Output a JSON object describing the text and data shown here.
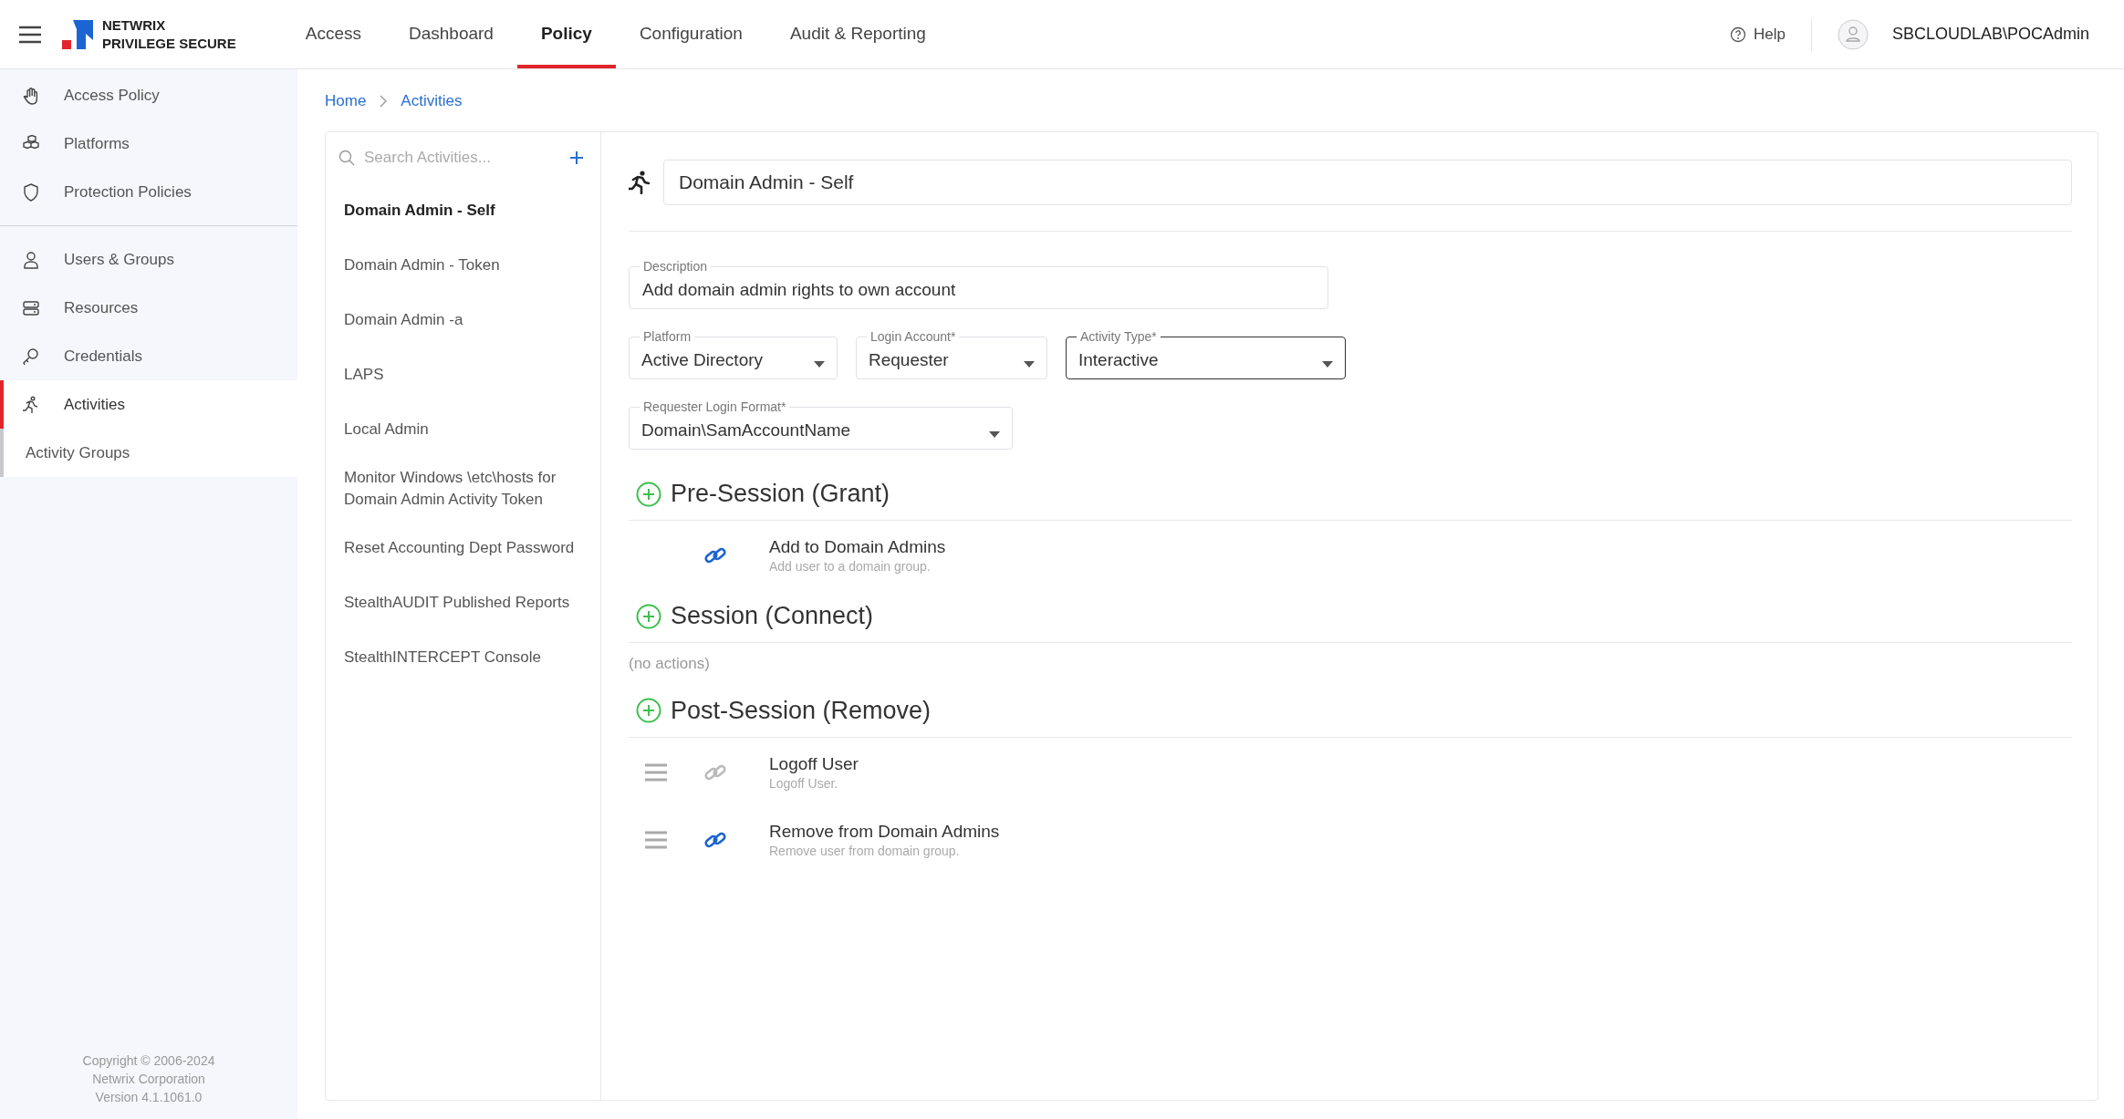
{
  "header": {
    "brand_line1": "NETWRIX",
    "brand_line2": "PRIVILEGE SECURE",
    "tabs": [
      {
        "label": "Access",
        "selected": false
      },
      {
        "label": "Dashboard",
        "selected": false
      },
      {
        "label": "Policy",
        "selected": true
      },
      {
        "label": "Configuration",
        "selected": false
      },
      {
        "label": "Audit & Reporting",
        "selected": false
      }
    ],
    "help": "Help",
    "user": "SBCLOUDLAB\\POCAdmin"
  },
  "sidebar": {
    "groups": [
      [
        {
          "label": "Access Policy",
          "kind": "hand",
          "selected": false
        },
        {
          "label": "Platforms",
          "kind": "cubes",
          "selected": false
        },
        {
          "label": "Protection Policies",
          "kind": "shield",
          "selected": false
        }
      ],
      [
        {
          "label": "Users & Groups",
          "kind": "user",
          "selected": false
        },
        {
          "label": "Resources",
          "kind": "server",
          "selected": false
        },
        {
          "label": "Credentials",
          "kind": "key",
          "selected": false
        },
        {
          "label": "Activities",
          "kind": "runner",
          "selected": true
        },
        {
          "label": "Activity Groups",
          "kind": "subitem",
          "selected": false
        }
      ]
    ],
    "footer": [
      "Copyright © 2006-2024",
      "Netwrix Corporation",
      "Version 4.1.1061.0"
    ]
  },
  "breadcrumb": [
    "Home",
    "Activities"
  ],
  "activity_list": {
    "placeholder": "Search Activities...",
    "items": [
      {
        "label": "Domain Admin - Self",
        "selected": true
      },
      {
        "label": "Domain Admin - Token",
        "selected": false
      },
      {
        "label": "Domain Admin -a",
        "selected": false
      },
      {
        "label": "LAPS",
        "selected": false
      },
      {
        "label": "Local Admin",
        "selected": false
      },
      {
        "label": "Monitor Windows \\etc\\hosts for Domain Admin Activity Token",
        "selected": false
      },
      {
        "label": "Reset Accounting Dept Password",
        "selected": false
      },
      {
        "label": "StealthAUDIT Published Reports",
        "selected": false
      },
      {
        "label": "StealthINTERCEPT Console",
        "selected": false
      }
    ]
  },
  "detail": {
    "name": "Domain Admin - Self",
    "description": {
      "label": "Description",
      "value": "Add domain admin rights to own account"
    },
    "dropdowns": [
      {
        "label": "Platform",
        "value": "Active Directory",
        "focused": false
      },
      {
        "label": "Login Account*",
        "value": "Requester",
        "focused": false
      },
      {
        "label": "Activity Type*",
        "value": "Interactive",
        "focused": true
      }
    ],
    "login_format": {
      "label": "Requester Login Format*",
      "value": "Domain\\SamAccountName"
    },
    "sections": [
      {
        "title": "Pre-Session (Grant)",
        "actions": [
          {
            "title": "Add to Domain Admins",
            "subtitle": "Add user to a domain group.",
            "enabled": true,
            "draggable": false
          }
        ]
      },
      {
        "title": "Session (Connect)",
        "empty_text": "(no actions)"
      },
      {
        "title": "Post-Session (Remove)",
        "actions": [
          {
            "title": "Logoff User",
            "subtitle": "Logoff User.",
            "enabled": false,
            "draggable": true
          },
          {
            "title": "Remove from Domain Admins",
            "subtitle": "Remove user from domain group.",
            "enabled": true,
            "draggable": true
          }
        ]
      }
    ]
  }
}
